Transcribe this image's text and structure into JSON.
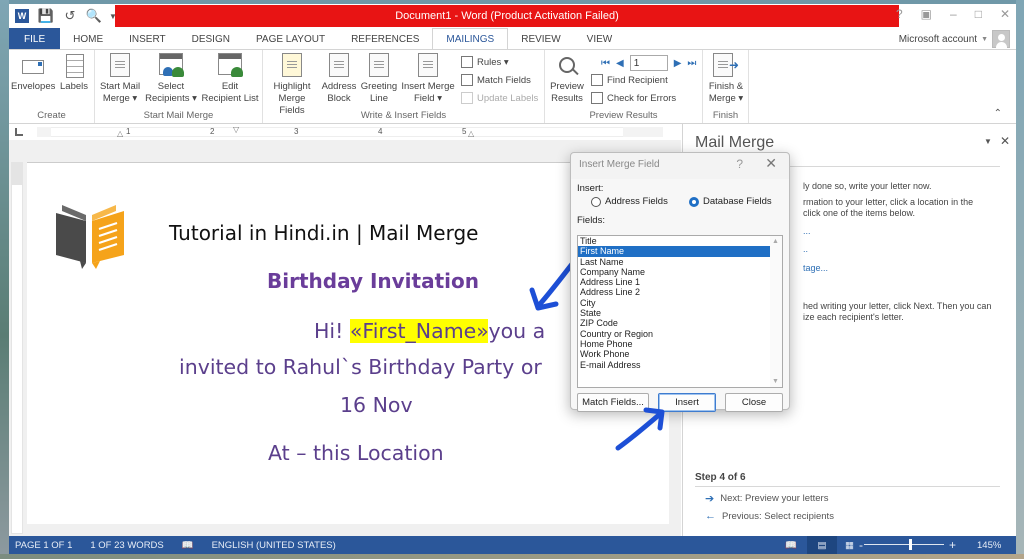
{
  "window": {
    "title": "Document1 - Word (Product Activation Failed)",
    "controls": [
      "?",
      "restore-ribbon",
      "minimize",
      "maximize",
      "close"
    ]
  },
  "quick_access": [
    "word-logo",
    "save",
    "undo",
    "print-preview",
    "customize"
  ],
  "tabs": [
    "FILE",
    "HOME",
    "INSERT",
    "DESIGN",
    "PAGE LAYOUT",
    "REFERENCES",
    "MAILINGS",
    "REVIEW",
    "VIEW"
  ],
  "active_tab": "MAILINGS",
  "account": {
    "label": "Microsoft account"
  },
  "ribbon": {
    "groups": {
      "create": {
        "label": "Create",
        "envelopes": "Envelopes",
        "labels": "Labels"
      },
      "start_mail_merge": {
        "label": "Start Mail Merge",
        "start_line1": "Start Mail",
        "start_line2": "Merge ▾",
        "select_line1": "Select",
        "select_line2": "Recipients ▾",
        "edit_line1": "Edit",
        "edit_line2": "Recipient List"
      },
      "write_insert": {
        "label": "Write & Insert Fields",
        "highlight_line1": "Highlight",
        "highlight_line2": "Merge Fields",
        "address_line1": "Address",
        "address_line2": "Block",
        "greeting_line1": "Greeting",
        "greeting_line2": "Line",
        "insert_line1": "Insert Merge",
        "insert_line2": "Field ▾",
        "rules": "Rules ▾",
        "match_fields": "Match Fields",
        "update_labels": "Update Labels"
      },
      "preview": {
        "label": "Preview Results",
        "preview_line1": "Preview",
        "preview_line2": "Results",
        "record": "1",
        "find_recipient": "Find Recipient",
        "check_errors": "Check for Errors"
      },
      "finish": {
        "label": "Finish",
        "finish_line1": "Finish &",
        "finish_line2": "Merge ▾"
      }
    }
  },
  "ruler": {
    "ticks": [
      "1",
      "2",
      "3",
      "4",
      "5"
    ]
  },
  "document": {
    "heading": "Tutorial in Hindi.in | Mail Merge",
    "subheading": "Birthday Invitation",
    "line1_prefix": "Hi! ",
    "merge_field": "«First_Name»",
    "line1_suffix": "you a",
    "line2": "invited to Rahul`s Birthday Party or",
    "line3": "16 Nov",
    "line4": "At – this Location"
  },
  "dialog": {
    "title": "Insert Merge Field",
    "help": "?",
    "insert_label": "Insert:",
    "radio_address": "Address Fields",
    "radio_database": "Database Fields",
    "selected_radio": "Database Fields",
    "fields_label": "Fields:",
    "fields": [
      "Title",
      "First Name",
      "Last Name",
      "Company Name",
      "Address Line 1",
      "Address Line 2",
      "City",
      "State",
      "ZIP Code",
      "Country or Region",
      "Home Phone",
      "Work Phone",
      "E-mail Address"
    ],
    "selected_field": "First Name",
    "match_fields_btn": "Match Fields...",
    "insert_btn": "Insert",
    "close_btn": "Close"
  },
  "task_pane": {
    "title": "Mail Merge",
    "text1": "ly done so, write your letter now.",
    "text2a": "rmation to your letter, click a location in the",
    "text2b": "click one of the items below.",
    "link1": "...",
    "link2": "..",
    "link3": "tage...",
    "text3a": "hed writing your letter, click Next. Then you can",
    "text3b": "ize each recipient's letter.",
    "step": "Step 4 of 6",
    "next": "Next: Preview your letters",
    "previous": "Previous: Select recipients"
  },
  "status_bar": {
    "page": "PAGE 1 OF 1",
    "words": "1 OF 23 WORDS",
    "language": "ENGLISH (UNITED STATES)",
    "zoom_minus": "-",
    "zoom_plus": "+",
    "zoom_level": "145%"
  }
}
